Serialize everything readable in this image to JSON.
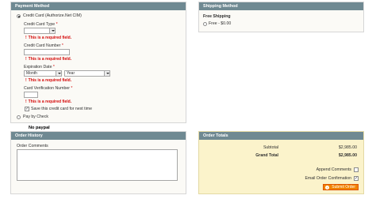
{
  "payment": {
    "title": "Payment Method",
    "cc_option": "Credit Card (Authorize.Net CIM)",
    "card_type_label": "Credit Card Type",
    "card_number_label": "Credit Card Number",
    "expiration_label": "Expiration Date",
    "exp_month": "Month",
    "exp_year": "Year",
    "cvv_label": "Card Verification Number",
    "required_marker": "*",
    "required_error": "This is a required field.",
    "save_card_label": "Save this credit card for next time",
    "check_option": "Pay by Check"
  },
  "shipping": {
    "title": "Shipping Method",
    "method_name": "Free Shipping",
    "option_label": "Free - $0.00"
  },
  "between_note": "No paypal",
  "history": {
    "title": "Order History",
    "comments_label": "Order Comments"
  },
  "totals": {
    "title": "Order Totals",
    "subtotal_label": "Subtotal",
    "subtotal_value": "$2,985.00",
    "grand_total_label": "Grand Total",
    "grand_total_value": "$2,985.00",
    "append_comments_label": "Append Comments",
    "email_confirmation_label": "Email Order Confirmation",
    "submit_label": "Submit Order"
  },
  "colors": {
    "header_bg": "#6f8992",
    "error": "#d40707",
    "totals_bg": "#fbf3cb",
    "button": "#f18200"
  }
}
